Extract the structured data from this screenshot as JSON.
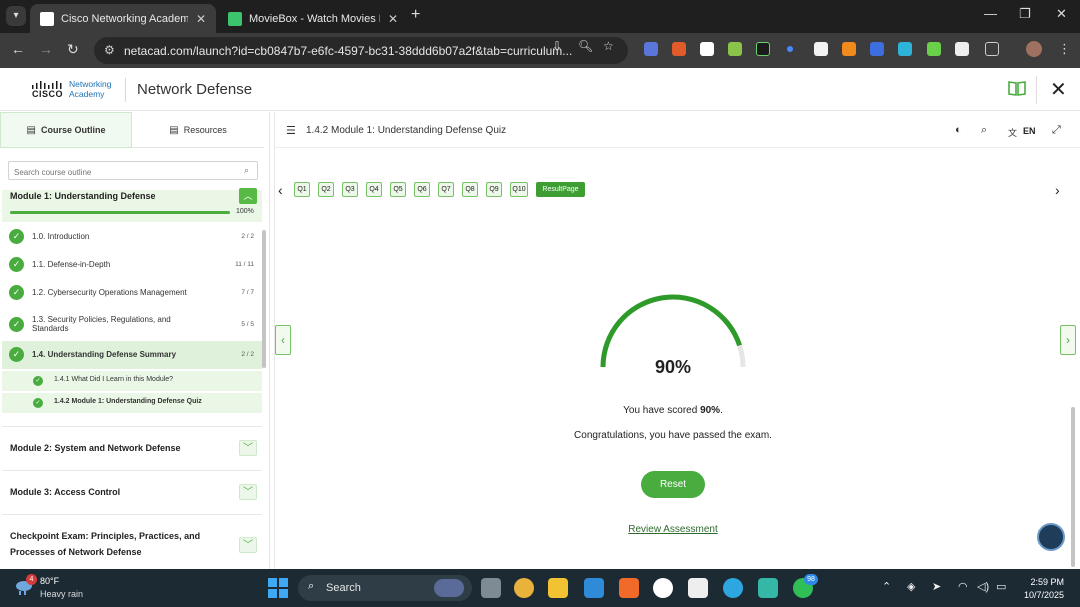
{
  "browser": {
    "tabs": [
      {
        "title": "Cisco Networking Academy: Ne",
        "close": "✕",
        "favicon_color": "#ffffff"
      },
      {
        "title": "MovieBox - Watch Movies Free",
        "close": "✕",
        "favicon_color": "#3cc46c"
      }
    ],
    "url": "netacad.com/launch?id=cb0847b7-e6fc-4597-bc31-38ddd6b07a2f&tab=curriculum...",
    "icons": [
      "chevron-down-icon",
      "plus-icon",
      "minimize-icon",
      "restore-icon",
      "close-icon",
      "back-icon",
      "forward-icon",
      "reload-icon",
      "site-settings-icon",
      "install-icon",
      "zoom-icon",
      "bookmark-star-icon",
      "extensions-icon",
      "profile-avatar-icon",
      "more-icon"
    ]
  },
  "app": {
    "brand_line1": "Networking",
    "brand_line2": "Academy",
    "brand_cisco": "CISCO",
    "course_title": "Network Defense"
  },
  "sidebar": {
    "tab_outline": "Course Outline",
    "tab_resources": "Resources",
    "search_placeholder": "Search course outline",
    "module1": {
      "title": "Module 1: Understanding Defense",
      "progress": "100%"
    },
    "lessons": [
      {
        "title": "1.0. Introduction",
        "count": "2 / 2"
      },
      {
        "title": "1.1. Defense-in-Depth",
        "count": "11 / 11"
      },
      {
        "title": "1.2. Cybersecurity Operations Management",
        "count": "7 / 7"
      },
      {
        "title": "1.3. Security Policies, Regulations, and",
        "title2": "Standards",
        "count": "5 / 5"
      },
      {
        "title": "1.4. Understanding Defense Summary",
        "count": "2 / 2"
      }
    ],
    "subs": [
      {
        "title": "1.4.1 What Did I Learn in this Module?"
      },
      {
        "title": "1.4.2 Module 1: Understanding Defense Quiz"
      }
    ],
    "modules": [
      {
        "title": "Module 2: System and Network Defense"
      },
      {
        "title": "Module 3: Access Control"
      },
      {
        "title": "Checkpoint Exam: Principles, Practices, and",
        "title2": "Processes of Network Defense"
      }
    ]
  },
  "main": {
    "header_title": "1.4.2 Module 1: Understanding Defense Quiz",
    "lang": "EN",
    "questions": [
      "Q1",
      "Q2",
      "Q3",
      "Q4",
      "Q5",
      "Q6",
      "Q7",
      "Q8",
      "Q9",
      "Q10"
    ],
    "result_label": "ResultPage",
    "score_value": 0.9,
    "score_text": "90%",
    "scored_prefix": "You have scored ",
    "scored_value": "90%",
    "scored_suffix": ".",
    "congrats": "Congratulations, you have passed the exam.",
    "reset": "Reset",
    "review": "Review Assessment",
    "accent": "#48ad3e"
  },
  "taskbar": {
    "temp": "80°F",
    "condition": "Heavy rain",
    "weather_badge": "4",
    "search": "Search",
    "whatsapp_badge": "98",
    "time": "2:59 PM",
    "date": "10/7/2025"
  }
}
